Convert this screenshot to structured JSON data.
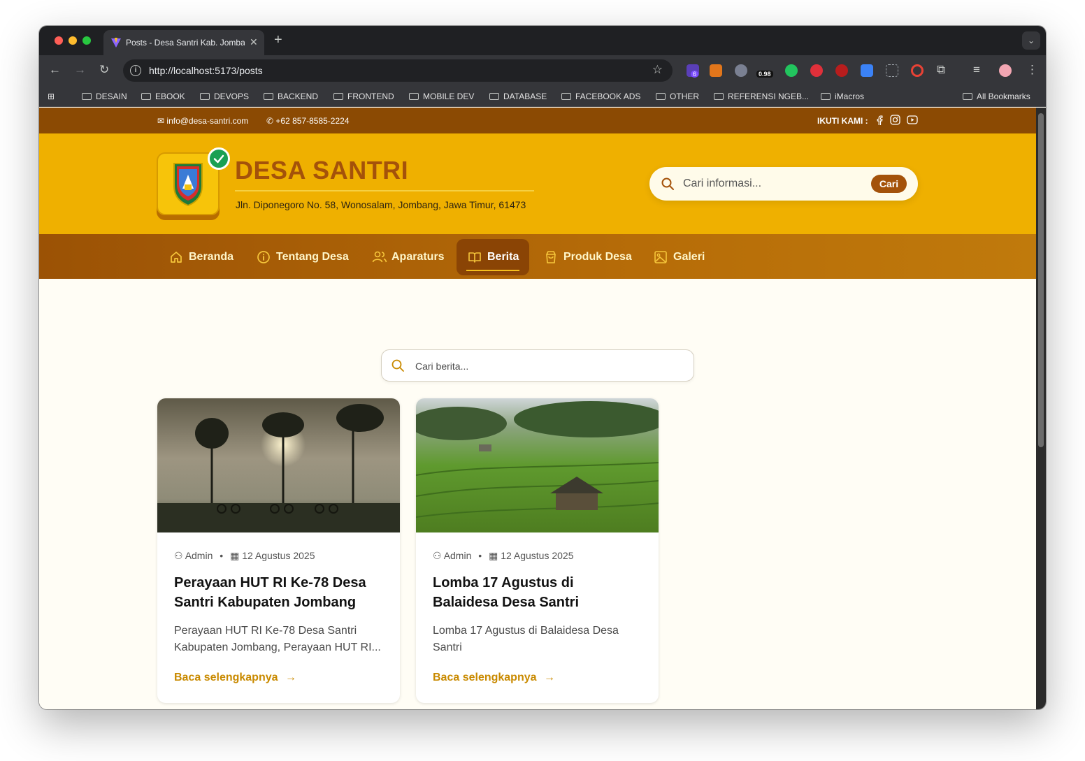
{
  "browser": {
    "tab_title": "Posts - Desa Santri Kab. Jombang",
    "url": "http://localhost:5173/posts",
    "extension_badge_count": "6",
    "extension_score": "0.98",
    "bookmarks": [
      "DESAIN",
      "EBOOK",
      "DEVOPS",
      "BACKEND",
      "FRONTEND",
      "MOBILE DEV",
      "DATABASE",
      "FACEBOOK ADS",
      "OTHER",
      "REFERENSI NGEB...",
      "iMacros"
    ],
    "all_bookmarks": "All Bookmarks"
  },
  "topbar": {
    "email": "info@desa-santri.com",
    "phone": "+62 857-8585-2224",
    "follow_label": "IKUTI KAMI :"
  },
  "header": {
    "site_name": "DESA SANTRI",
    "address": "Jln. Diponegoro No. 58, Wonosalam, Jombang, Jawa Timur, 61473",
    "search_placeholder": "Cari informasi...",
    "search_button": "Cari"
  },
  "nav": {
    "items": [
      {
        "label": "Beranda",
        "icon": "home-icon"
      },
      {
        "label": "Tentang Desa",
        "icon": "info-icon"
      },
      {
        "label": "Aparaturs",
        "icon": "users-icon"
      },
      {
        "label": "Berita",
        "icon": "book-icon",
        "active": true
      },
      {
        "label": "Produk Desa",
        "icon": "shopping-bag-icon"
      },
      {
        "label": "Galeri",
        "icon": "image-icon"
      }
    ]
  },
  "posts_search": {
    "placeholder": "Cari berita..."
  },
  "posts": [
    {
      "author": "Admin",
      "date": "12 Agustus 2025",
      "title": "Perayaan HUT RI Ke-78 Desa Santri Kabupaten Jombang",
      "excerpt": "Perayaan HUT RI Ke-78 Desa Santri Kabupaten Jombang, Perayaan HUT RI...",
      "read_more": "Baca selengkapnya"
    },
    {
      "author": "Admin",
      "date": "12 Agustus 2025",
      "title": "Lomba 17 Agustus di Balaidesa Desa Santri",
      "excerpt": "Lomba 17 Agustus di Balaidesa Desa Santri",
      "read_more": "Baca selengkapnya"
    }
  ],
  "colors": {
    "topbar": "#8b4a03",
    "header": "#efb000",
    "brand_text": "#a4520a",
    "link": "#c98a00"
  }
}
